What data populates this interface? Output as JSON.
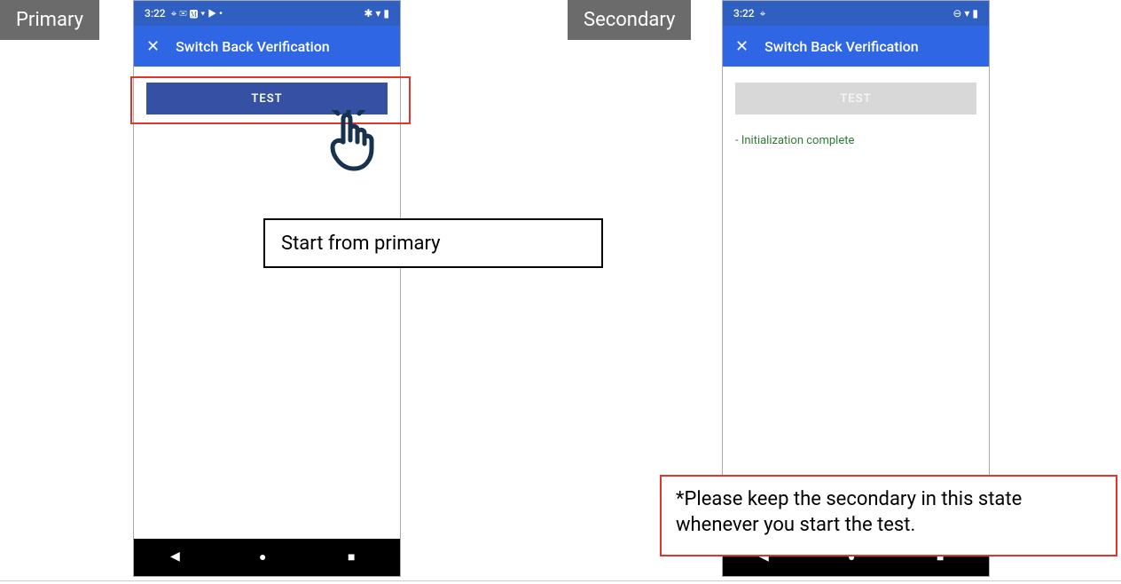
{
  "labels": {
    "primary": "Primary",
    "secondary": "Secondary"
  },
  "primary_phone": {
    "status": {
      "time": "3:22",
      "left_icons": "⌖ ✉ 🅼 ▾ ▶ •",
      "right_icons": "✱ ▾ ▮"
    },
    "appbar": {
      "title": "Switch Back Verification",
      "close": "✕"
    },
    "test_button": "TEST"
  },
  "secondary_phone": {
    "status": {
      "time": "3:22",
      "left_icons": "⌖",
      "right_icons": "⊖ ▾ ▮"
    },
    "appbar": {
      "title": "Switch Back Verification",
      "close": "✕"
    },
    "test_button": "TEST",
    "status_line": "- Initialization complete"
  },
  "annotations": {
    "primary_callout": "Start from primary",
    "secondary_callout": "*Please keep the secondary in this state whenever you start the test."
  },
  "nav": {
    "back": "◀",
    "home": "●",
    "recent": "■"
  }
}
